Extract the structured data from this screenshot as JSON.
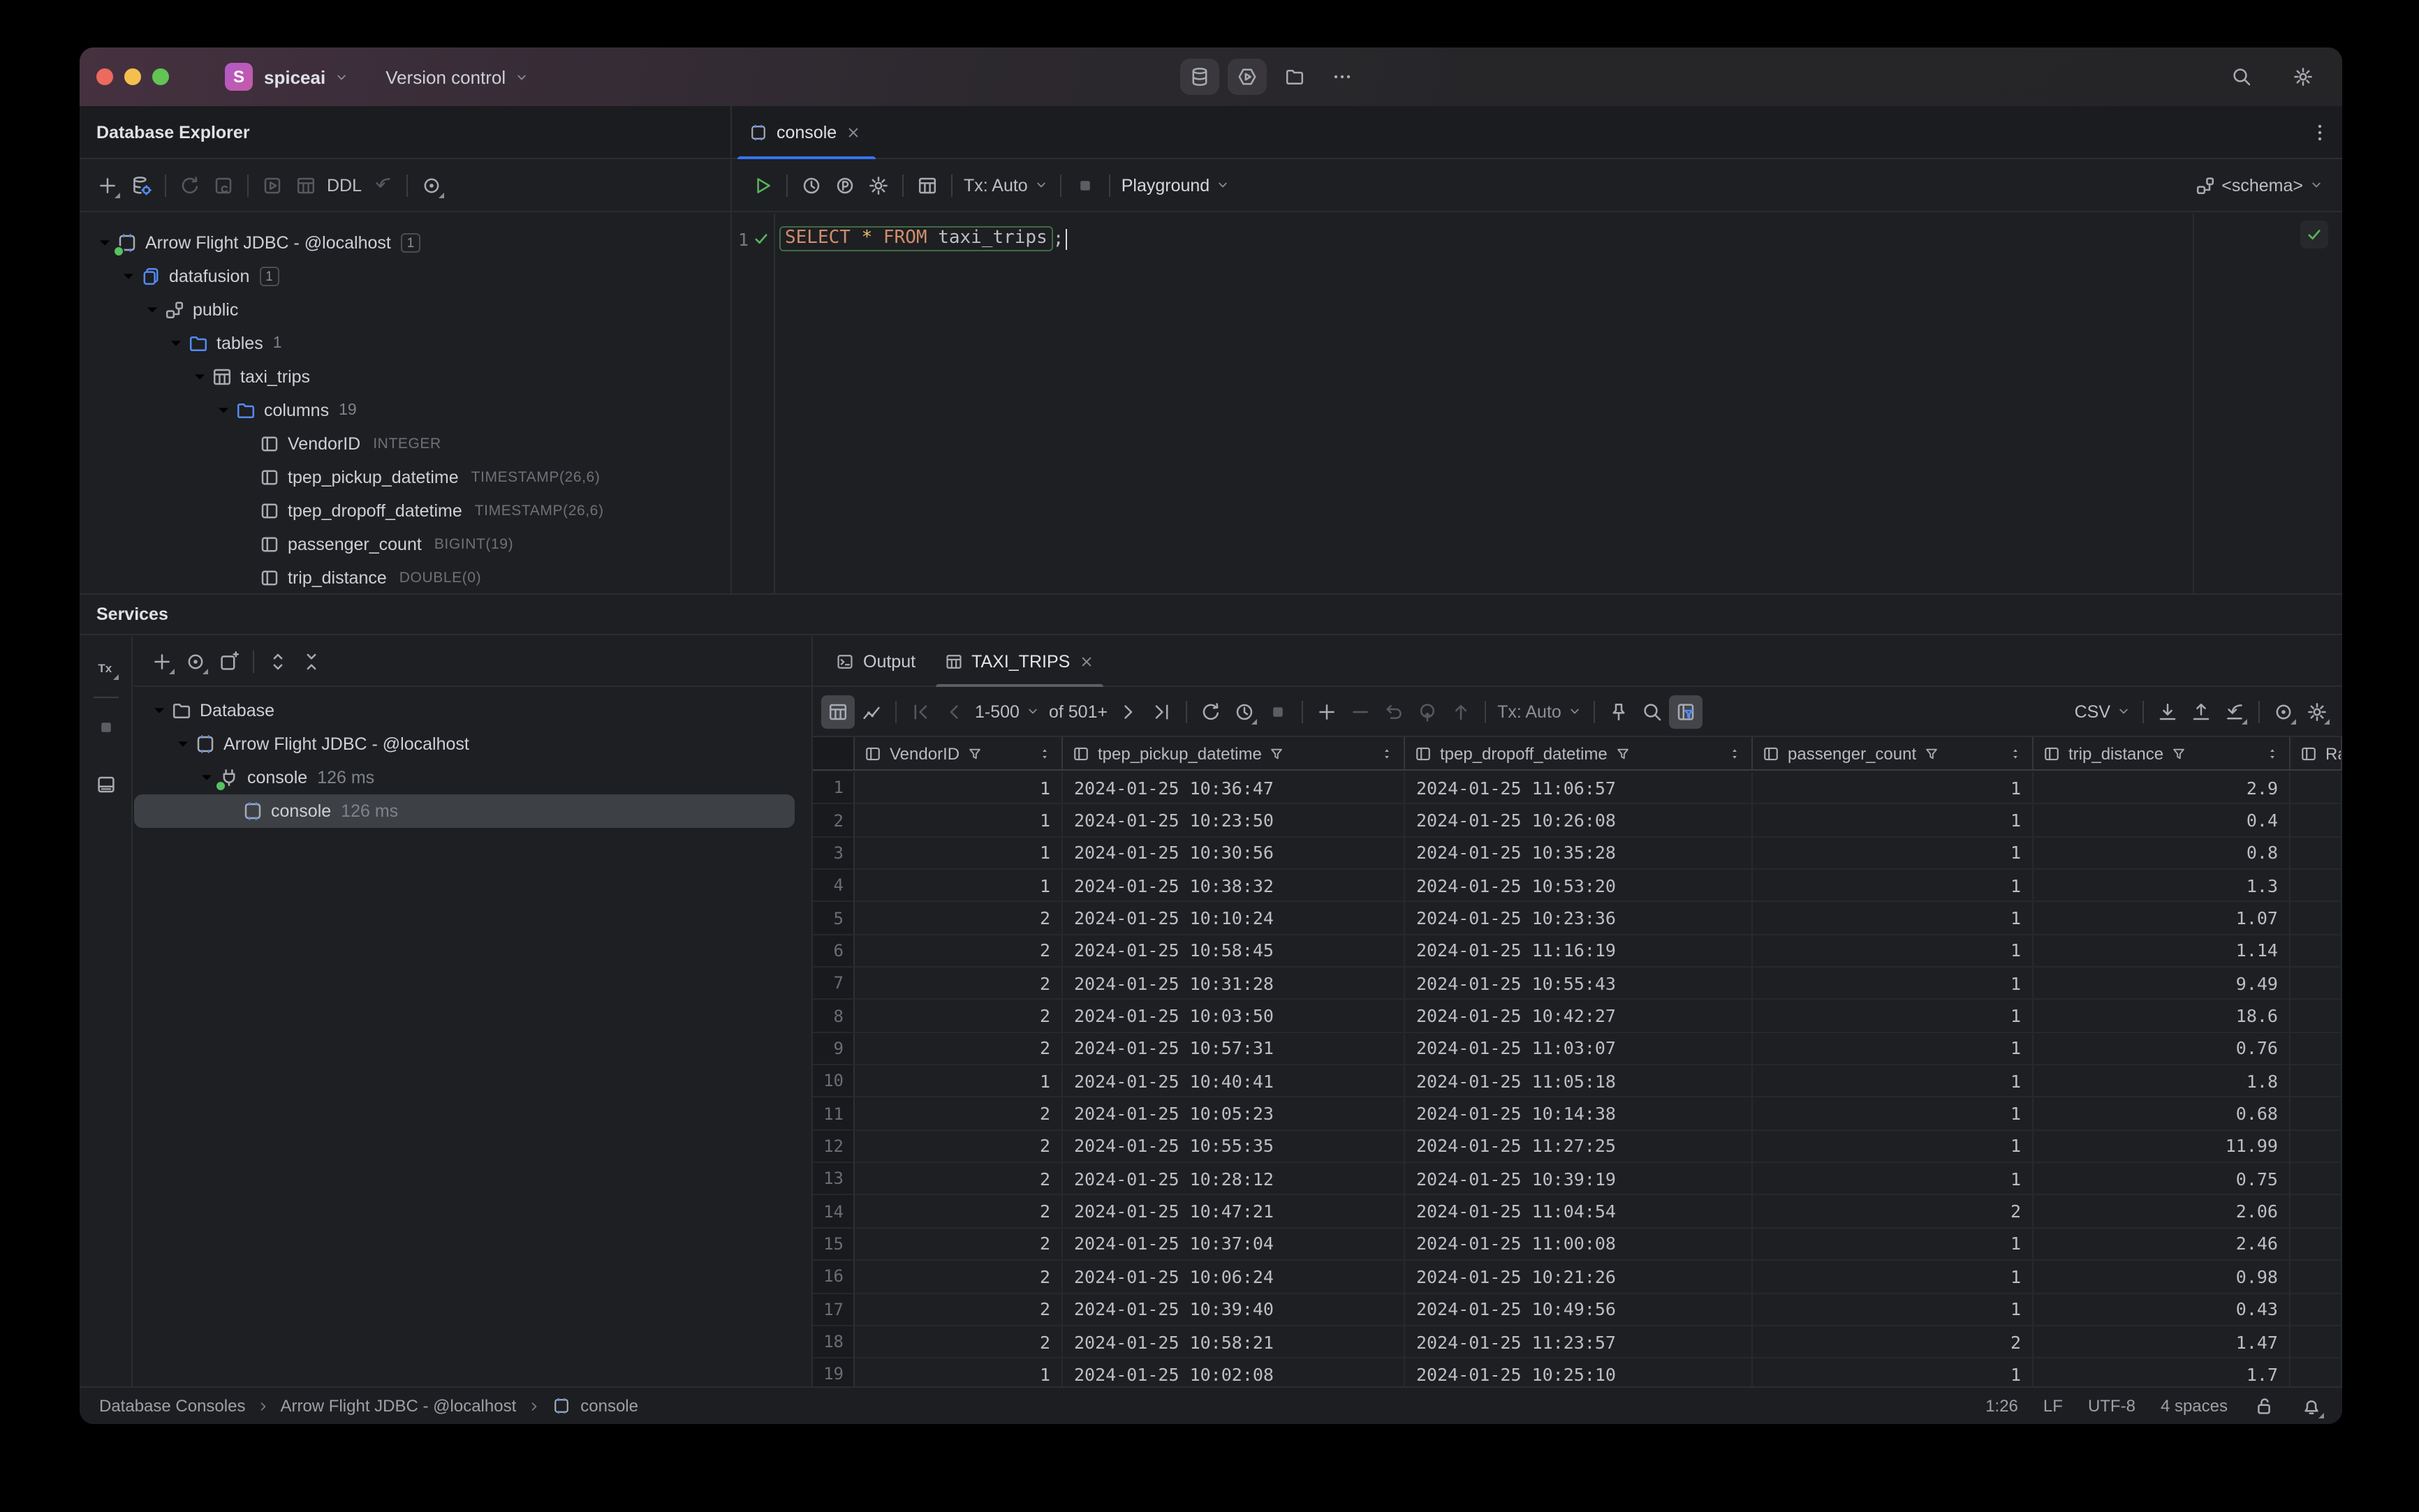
{
  "titlebar": {
    "project_initial": "S",
    "project_name": "spiceai",
    "menu_label": "Version control",
    "center_icons": [
      {
        "icon": "database",
        "name": "database-tool-button",
        "tile": true
      },
      {
        "icon": "hexplay",
        "name": "services-tool-button",
        "tile": true
      },
      {
        "icon": "folder",
        "name": "project-files-button"
      },
      {
        "icon": "ellipsis",
        "name": "more-tools-button"
      }
    ],
    "right_icons": [
      {
        "icon": "search",
        "name": "search-everywhere-button"
      },
      {
        "icon": "settings",
        "name": "ide-settings-button"
      }
    ]
  },
  "database_explorer": {
    "title": "Database Explorer",
    "toolbar": [
      {
        "icon": "plus",
        "name": "new-datasource-button",
        "corner": true
      },
      {
        "icon": "dbsettings",
        "name": "datasource-properties-button"
      },
      {
        "divider": true
      },
      {
        "icon": "refresh",
        "name": "refresh-button",
        "disabled": true
      },
      {
        "icon": "cancelq",
        "name": "cancel-query-button",
        "disabled": true
      },
      {
        "divider": true
      },
      {
        "icon": "openconsole",
        "name": "jump-to-console-button",
        "disabled": true
      },
      {
        "icon": "tablegrid",
        "name": "open-table-button",
        "disabled": true
      },
      {
        "text": "DDL",
        "name": "ddl-button",
        "disabled": true
      },
      {
        "icon": "jumpddl",
        "name": "jump-to-ddl-button",
        "disabled": true
      },
      {
        "divider": true
      },
      {
        "icon": "locate",
        "name": "select-opened-element-button",
        "corner": true
      }
    ],
    "tree": [
      {
        "level": 0,
        "chevron": true,
        "icon": "consolefile",
        "green_dot": true,
        "label": "Arrow Flight JDBC - @localhost",
        "badge": "1"
      },
      {
        "level": 1,
        "chevron": true,
        "icon": "dbblue",
        "label": "datafusion",
        "badge": "1"
      },
      {
        "level": 2,
        "chevron": true,
        "icon": "schema",
        "label": "public"
      },
      {
        "level": 3,
        "chevron": true,
        "icon": "folder",
        "folder_blue": true,
        "label": "tables",
        "count": "1"
      },
      {
        "level": 4,
        "chevron": true,
        "icon": "tablegrid",
        "label": "taxi_trips"
      },
      {
        "level": 5,
        "chevron": true,
        "icon": "folder",
        "folder_blue": true,
        "label": "columns",
        "count": "19"
      },
      {
        "level": 6,
        "icon": "column",
        "label": "VendorID",
        "type": "INTEGER"
      },
      {
        "level": 6,
        "icon": "column",
        "label": "tpep_pickup_datetime",
        "type": "TIMESTAMP(26,6)"
      },
      {
        "level": 6,
        "icon": "column",
        "label": "tpep_dropoff_datetime",
        "type": "TIMESTAMP(26,6)"
      },
      {
        "level": 6,
        "icon": "column",
        "label": "passenger_count",
        "type": "BIGINT(19)"
      },
      {
        "level": 6,
        "icon": "column",
        "label": "trip_distance",
        "type": "DOUBLE(0)"
      }
    ]
  },
  "editor": {
    "tab_label": "console",
    "toolbar_left": [
      {
        "icon": "run",
        "name": "execute-button",
        "green": true
      },
      {
        "divider": true
      },
      {
        "icon": "clock",
        "name": "query-history-button"
      },
      {
        "icon": "circledp",
        "name": "parameters-button"
      },
      {
        "icon": "settings",
        "name": "console-settings-button"
      },
      {
        "divider": true
      },
      {
        "icon": "tablegrid",
        "name": "browse-tables-button"
      },
      {
        "divider": true
      },
      {
        "text": "Tx: Auto",
        "name": "tx-mode-select",
        "caret": true
      },
      {
        "divider": true
      },
      {
        "icon": "stopfill",
        "name": "stop-button",
        "gray": true
      },
      {
        "divider": true
      },
      {
        "text": "Playground",
        "name": "run-mode-select",
        "caret": true,
        "bright": true
      }
    ],
    "schema_label": "<schema>",
    "line_number": "1",
    "sql_tokens": [
      {
        "text": "SELECT",
        "style": "keyword"
      },
      {
        "text": " ",
        "style": "plain"
      },
      {
        "text": "*",
        "style": "star"
      },
      {
        "text": " ",
        "style": "plain"
      },
      {
        "text": "FROM",
        "style": "keyword"
      },
      {
        "text": " ",
        "style": "plain"
      },
      {
        "text": "taxi_trips",
        "style": "plain"
      }
    ],
    "statement_terminator": ";"
  },
  "services": {
    "title": "Services",
    "side_icons": [
      {
        "icon": "tx",
        "name": "tx-toggle",
        "corner": true
      },
      {
        "hr": true
      },
      {
        "icon": "stopfill",
        "name": "stop-process-button",
        "gray": true
      },
      {
        "icon": "bottompanel",
        "name": "hide-panel-button",
        "gap": true
      }
    ],
    "toolbar": [
      {
        "icon": "plus",
        "name": "add-service-button",
        "corner": true
      },
      {
        "icon": "locate",
        "name": "locate-service-button",
        "corner": true
      },
      {
        "icon": "newtab",
        "name": "open-in-new-tab-button"
      },
      {
        "divider": true
      },
      {
        "icon": "expand",
        "name": "expand-all-button"
      },
      {
        "icon": "collapse",
        "name": "collapse-all-button"
      }
    ],
    "tree": [
      {
        "level": 0,
        "chevron": true,
        "icon": "folder",
        "label": "Database"
      },
      {
        "level": 1,
        "chevron": true,
        "icon": "consolefile",
        "label": "Arrow Flight JDBC - @localhost"
      },
      {
        "level": 2,
        "chevron": true,
        "icon": "plug",
        "green_dot": true,
        "label": "console",
        "time": "126 ms"
      },
      {
        "level": 3,
        "icon": "consolefile",
        "label": "console",
        "time": "126 ms",
        "selected": true
      }
    ]
  },
  "results": {
    "output_tab": "Output",
    "result_tab": "TAXI_TRIPS",
    "toolbar": [
      {
        "icon": "tablegrid",
        "name": "grid-view-button",
        "active": true
      },
      {
        "icon": "chart",
        "name": "chart-view-button"
      },
      {
        "divider": true
      },
      {
        "icon": "firstpg",
        "name": "first-page-button",
        "disabled": true
      },
      {
        "icon": "prevpg",
        "name": "previous-page-button",
        "disabled": true
      },
      {
        "text": "1-500",
        "name": "page-size-select",
        "caret": true
      },
      {
        "text": "of 501+",
        "name": "total-rows-label",
        "static": true
      },
      {
        "icon": "nextpg",
        "name": "next-page-button"
      },
      {
        "icon": "lastpg",
        "name": "last-page-button"
      },
      {
        "divider": true
      },
      {
        "icon": "refresh",
        "name": "reload-data-button"
      },
      {
        "icon": "clock",
        "name": "auto-refresh-button",
        "corner": true
      },
      {
        "icon": "stopfill",
        "name": "stop-query-button",
        "gray": true
      },
      {
        "divider": true
      },
      {
        "icon": "plus",
        "name": "add-row-button"
      },
      {
        "icon": "minus",
        "name": "delete-row-button",
        "disabled": true
      },
      {
        "icon": "undo",
        "name": "revert-button",
        "disabled": true
      },
      {
        "icon": "submit",
        "name": "submit-button",
        "disabled": true
      },
      {
        "icon": "arrowup",
        "name": "commit-button",
        "disabled": true
      },
      {
        "divider": true
      },
      {
        "text": "Tx: Auto",
        "name": "tx-mode-select",
        "caret": true,
        "muted": true
      },
      {
        "divider": true
      },
      {
        "icon": "pin",
        "name": "pin-tab-button"
      },
      {
        "icon": "search",
        "name": "find-in-grid-button"
      },
      {
        "icon": "funnelcol",
        "name": "column-filter-button",
        "active": true
      },
      {
        "spacer": true
      },
      {
        "text": "CSV",
        "name": "export-format-select",
        "caret": true
      },
      {
        "divider": true
      },
      {
        "icon": "download",
        "name": "import-data-button"
      },
      {
        "icon": "upload",
        "name": "export-data-button"
      },
      {
        "icon": "importddl",
        "name": "modify-object-button",
        "corner": true
      },
      {
        "divider": true
      },
      {
        "icon": "locate",
        "name": "locate-row-button",
        "corner": true
      },
      {
        "icon": "settings",
        "name": "grid-settings-button",
        "corner": true
      }
    ],
    "columns": [
      {
        "label": "VendorID",
        "filter": true,
        "sort": true
      },
      {
        "label": "tpep_pickup_datetime",
        "filter": true,
        "sort": true
      },
      {
        "label": "tpep_dropoff_datetime",
        "filter": true,
        "sort": true
      },
      {
        "label": "passenger_count",
        "filter": true,
        "sort": true
      },
      {
        "label": "trip_distance",
        "filter": true,
        "sort": true
      },
      {
        "label": "Rate",
        "filter": false,
        "sort": false
      }
    ],
    "rows": [
      [
        "1",
        "2024-01-25 10:36:47",
        "2024-01-25 11:06:57",
        "1",
        "2.9"
      ],
      [
        "1",
        "2024-01-25 10:23:50",
        "2024-01-25 10:26:08",
        "1",
        "0.4"
      ],
      [
        "1",
        "2024-01-25 10:30:56",
        "2024-01-25 10:35:28",
        "1",
        "0.8"
      ],
      [
        "1",
        "2024-01-25 10:38:32",
        "2024-01-25 10:53:20",
        "1",
        "1.3"
      ],
      [
        "2",
        "2024-01-25 10:10:24",
        "2024-01-25 10:23:36",
        "1",
        "1.07"
      ],
      [
        "2",
        "2024-01-25 10:58:45",
        "2024-01-25 11:16:19",
        "1",
        "1.14"
      ],
      [
        "2",
        "2024-01-25 10:31:28",
        "2024-01-25 10:55:43",
        "1",
        "9.49"
      ],
      [
        "2",
        "2024-01-25 10:03:50",
        "2024-01-25 10:42:27",
        "1",
        "18.6"
      ],
      [
        "2",
        "2024-01-25 10:57:31",
        "2024-01-25 11:03:07",
        "1",
        "0.76"
      ],
      [
        "1",
        "2024-01-25 10:40:41",
        "2024-01-25 11:05:18",
        "1",
        "1.8"
      ],
      [
        "2",
        "2024-01-25 10:05:23",
        "2024-01-25 10:14:38",
        "1",
        "0.68"
      ],
      [
        "2",
        "2024-01-25 10:55:35",
        "2024-01-25 11:27:25",
        "1",
        "11.99"
      ],
      [
        "2",
        "2024-01-25 10:28:12",
        "2024-01-25 10:39:19",
        "1",
        "0.75"
      ],
      [
        "2",
        "2024-01-25 10:47:21",
        "2024-01-25 11:04:54",
        "2",
        "2.06"
      ],
      [
        "2",
        "2024-01-25 10:37:04",
        "2024-01-25 11:00:08",
        "1",
        "2.46"
      ],
      [
        "2",
        "2024-01-25 10:06:24",
        "2024-01-25 10:21:26",
        "1",
        "0.98"
      ],
      [
        "2",
        "2024-01-25 10:39:40",
        "2024-01-25 10:49:56",
        "1",
        "0.43"
      ],
      [
        "2",
        "2024-01-25 10:58:21",
        "2024-01-25 11:23:57",
        "2",
        "1.47"
      ],
      [
        "1",
        "2024-01-25 10:02:08",
        "2024-01-25 10:25:10",
        "1",
        "1.7"
      ]
    ]
  },
  "status_bar": {
    "breadcrumbs": [
      "Database Consoles",
      "Arrow Flight JDBC - @localhost",
      "console"
    ],
    "caret_position": "1:26",
    "line_ending": "LF",
    "encoding": "UTF-8",
    "indent": "4 spaces"
  },
  "colors": {
    "accent_blue": "#3574f0",
    "icon_blue": "#548af7",
    "success_green": "#57b35f",
    "keyword_orange": "#cf8e6d",
    "star_yellow": "#e8bf6a"
  }
}
